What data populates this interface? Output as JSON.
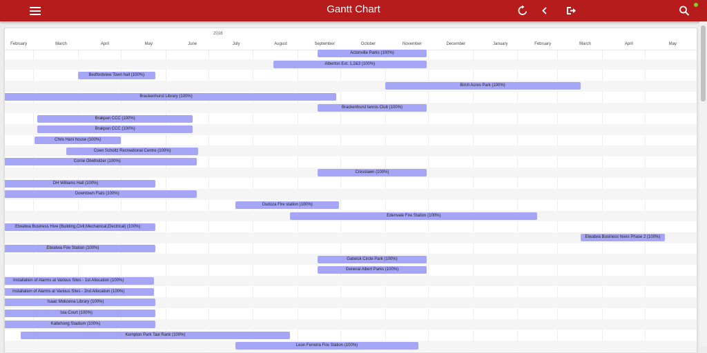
{
  "app": {
    "title": "Gantt Chart"
  },
  "toolbar": {
    "menu_icon": "menu-icon",
    "refresh_icon": "refresh-icon",
    "back_icon": "chevron-left-icon",
    "exit_icon": "exit-icon",
    "search_icon": "search-icon",
    "bar_color": "#b71c1c"
  },
  "timeline": {
    "year_label": "2018",
    "months": [
      "February",
      "March",
      "April",
      "May",
      "June",
      "July",
      "August",
      "September",
      "October",
      "November",
      "December",
      "January",
      "February",
      "March",
      "April",
      "May"
    ]
  },
  "tasks": [
    {
      "label": "Actonville Parks (100%)",
      "start": "2018-09-15",
      "end": "2018-11-30"
    },
    {
      "label": "Alberton Ext. 1,2&3 (100%)",
      "start": "2018-08-15",
      "end": "2018-11-30"
    },
    {
      "label": "Bedfordview Town hall (100%)",
      "start": "2018-04-01",
      "end": "2018-05-25"
    },
    {
      "label": "Birch Acres Park (100%)",
      "start": "2018-11-01",
      "end": "2019-03-17"
    },
    {
      "label": "Brackenhurst Library (100%)",
      "start": "2018-02-03",
      "end": "2018-09-28"
    },
    {
      "label": "Brackenhurst tennis Club (100%)",
      "start": "2018-09-15",
      "end": "2018-11-30"
    },
    {
      "label": "Brakpan CCC (100%)",
      "start": "2018-03-04",
      "end": "2018-06-20"
    },
    {
      "label": "Brakpan CCC (100%)",
      "start": "2018-03-04",
      "end": "2018-06-20"
    },
    {
      "label": "Chris Hani house (100%)",
      "start": "2018-03-02",
      "end": "2018-05-01"
    },
    {
      "label": "Coen Scholtz Recreational Centre (100%)",
      "start": "2018-03-24",
      "end": "2018-06-24"
    },
    {
      "label": "Corrie Obelholzer (100%)",
      "start": "2018-02-04",
      "end": "2018-06-23"
    },
    {
      "label": "Cresslawn (100%)",
      "start": "2018-09-15",
      "end": "2018-11-30"
    },
    {
      "label": "DH Williams Hall (100%)",
      "start": "2018-02-03",
      "end": "2018-05-25"
    },
    {
      "label": "Downtown Flats (100%)",
      "start": "2018-02-04",
      "end": "2018-06-23"
    },
    {
      "label": "Duduza Fire station (100%)",
      "start": "2018-07-20",
      "end": "2018-09-30"
    },
    {
      "label": "Edenvale Fire Station (100%)",
      "start": "2018-08-27",
      "end": "2019-02-15"
    },
    {
      "label": "Etwatwa Business Hive (Building,Civil,Mechanical,Electrical) (100%)",
      "start": "2018-02-06",
      "end": "2018-05-25"
    },
    {
      "label": "Etwatwa Business hives Phase 2 (100%)",
      "start": "2019-03-17",
      "end": "2019-05-15"
    },
    {
      "label": "Etwatwa Fire Station (100%)",
      "start": "2018-01-30",
      "end": "2018-05-25"
    },
    {
      "label": "Gatwick Circle Park (100%)",
      "start": "2018-09-15",
      "end": "2018-11-30"
    },
    {
      "label": "General Albert Parks (100%)",
      "start": "2018-09-15",
      "end": "2018-11-30"
    },
    {
      "label": "Installation of Alarms at Various Sites - 1st Allocation (100%)",
      "start": "2018-01-25",
      "end": "2018-05-24"
    },
    {
      "label": "Installation of Alarms at Various Sites - 2nd Allocation (100%)",
      "start": "2018-01-25",
      "end": "2018-05-24"
    },
    {
      "label": "Isaac Mokoena Library (100%)",
      "start": "2018-02-03",
      "end": "2018-05-25"
    },
    {
      "label": "Isia Court (100%)",
      "start": "2018-02-04",
      "end": "2018-05-25"
    },
    {
      "label": "Katlehong Stadium (100%)",
      "start": "2018-02-03",
      "end": "2018-05-25"
    },
    {
      "label": "Kempton Park Taxi Rank (100%)",
      "start": "2018-02-20",
      "end": "2018-08-27"
    },
    {
      "label": "Leon Ferreira Fire Station (100%)",
      "start": "2018-07-20",
      "end": "2018-11-24"
    }
  ]
}
